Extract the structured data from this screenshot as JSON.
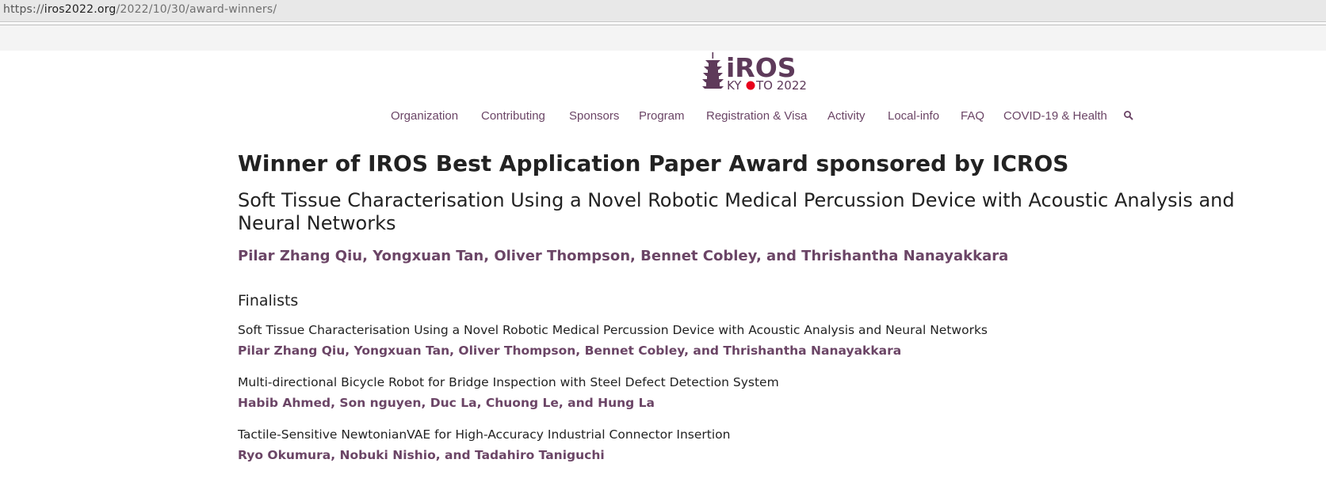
{
  "browser": {
    "url_scheme": "https://",
    "url_host": "iros2022.org",
    "url_path": "/2022/10/30/award-winners/"
  },
  "logo": {
    "text_main": "iROS",
    "text_sub_1": "KY",
    "text_sub_2": "TO 2022",
    "accent_color": "#e8001c",
    "brand_color": "#5e3a5a"
  },
  "nav": {
    "items": [
      {
        "label": "Organization"
      },
      {
        "label": "Contributing"
      },
      {
        "label": "Sponsors"
      },
      {
        "label": "Program"
      },
      {
        "label": "Registration & Visa"
      },
      {
        "label": "Activity"
      },
      {
        "label": "Local-info"
      },
      {
        "label": "FAQ"
      },
      {
        "label": "COVID-19 & Health"
      }
    ],
    "search_icon": "search-icon"
  },
  "award": {
    "heading": "Winner of IROS Best Application Paper Award sponsored by ICROS",
    "paper_title": "Soft Tissue Characterisation Using a Novel Robotic Medical Percussion Device with Acoustic Analysis and Neural Networks",
    "authors": "Pilar Zhang Qiu, Yongxuan Tan, Oliver Thompson, Bennet Cobley,  and Thrishantha Nanayakkara"
  },
  "finalists": {
    "heading": "Finalists",
    "entries": [
      {
        "title": "Soft Tissue Characterisation Using a Novel Robotic Medical Percussion Device with Acoustic Analysis and Neural Networks",
        "authors": "Pilar Zhang Qiu, Yongxuan Tan, Oliver Thompson, Bennet Cobley, and Thrishantha Nanayakkara"
      },
      {
        "title": "Multi-directional Bicycle Robot for Bridge Inspection with Steel Defect Detection System",
        "authors": "Habib Ahmed, Son nguyen, Duc La, Chuong Le, and Hung La"
      },
      {
        "title": "Tactile-Sensitive NewtonianVAE for High-Accuracy Industrial Connector Insertion",
        "authors": "Ryo Okumura, Nobuki Nishio, and Tadahiro Taniguchi"
      }
    ]
  },
  "colors": {
    "link": "#6b4566",
    "text": "#222222"
  }
}
